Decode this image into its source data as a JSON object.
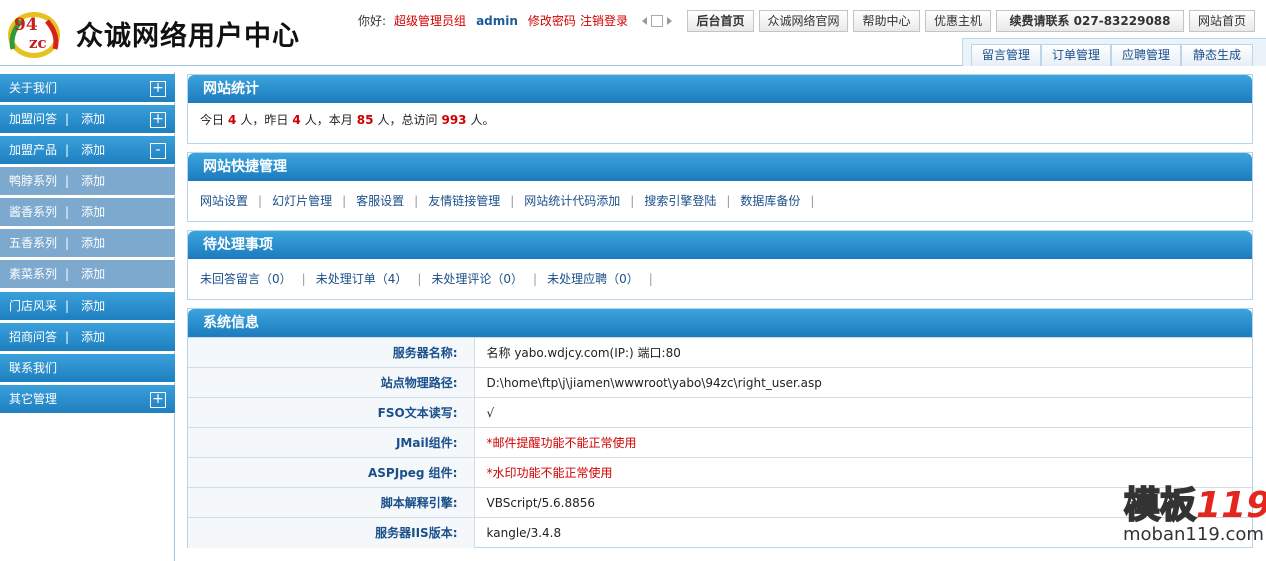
{
  "header": {
    "logo_text": "94zc",
    "brand": "众诚网络用户中心",
    "greeting": "你好:",
    "role": "超级管理员组",
    "username": "admin",
    "change_password": "修改密码",
    "logout": "注销登录",
    "top_buttons": [
      "后台首页",
      "众诚网络官网",
      "帮助中心",
      "优惠主机",
      "续费请联系 027-83229088",
      "网站首页"
    ],
    "tabs": [
      "留言管理",
      "订单管理",
      "应聘管理",
      "静态生成"
    ]
  },
  "sidebar": {
    "items": [
      {
        "label": "关于我们",
        "add": "",
        "toggle": "+"
      },
      {
        "label": "加盟问答",
        "add": "添加",
        "toggle": "+"
      },
      {
        "label": "加盟产品",
        "add": "添加",
        "toggle": "-"
      },
      {
        "label": "鸭脖系列",
        "add": "添加",
        "toggle": ""
      },
      {
        "label": "酱香系列",
        "add": "添加",
        "toggle": ""
      },
      {
        "label": "五香系列",
        "add": "添加",
        "toggle": ""
      },
      {
        "label": "素菜系列",
        "add": "添加",
        "toggle": ""
      },
      {
        "label": "门店风采",
        "add": "添加",
        "toggle": ""
      },
      {
        "label": "招商问答",
        "add": "添加",
        "toggle": ""
      },
      {
        "label": "联系我们",
        "add": "",
        "toggle": ""
      },
      {
        "label": "其它管理",
        "add": "",
        "toggle": "+"
      }
    ],
    "separator": "|"
  },
  "stats": {
    "title": "网站统计",
    "today_label": "今日",
    "today": "4",
    "yesterday_label": "人，昨日",
    "yesterday": "4",
    "month_label": "人，本月",
    "month": "85",
    "total_label": "人，总访问",
    "total": "993",
    "end": "人。"
  },
  "quick": {
    "title": "网站快捷管理",
    "links": [
      "网站设置",
      "幻灯片管理",
      "客服设置",
      "友情链接管理",
      "网站统计代码添加",
      "搜索引擎登陆",
      "数据库备份"
    ],
    "separator": "|"
  },
  "pending": {
    "title": "待处理事项",
    "links": [
      "未回答留言（0）",
      "未处理订单（4）",
      "未处理评论（0）",
      "未处理应聘（0）"
    ],
    "separator": "|"
  },
  "system": {
    "title": "系统信息",
    "rows": [
      {
        "key": "服务器名称:",
        "value": "名称 yabo.wdjcy.com(IP:) 端口:80"
      },
      {
        "key": "站点物理路径:",
        "value": "D:\\home\\ftp\\j\\jiamen\\wwwroot\\yabo\\94zc\\right_user.asp"
      },
      {
        "key": "FSO文本读写:",
        "value": "√"
      },
      {
        "key": "JMail组件:",
        "value": "*邮件提醒功能不能正常使用"
      },
      {
        "key": "ASPJpeg 组件:",
        "value": "*水印功能不能正常使用"
      },
      {
        "key": "脚本解释引擎:",
        "value": "VBScript/5.6.8856"
      },
      {
        "key": "服务器IIS版本:",
        "value": "kangle/3.4.8"
      }
    ]
  },
  "watermark": {
    "cn": "模板",
    "num": "119",
    "site": "moban119.com"
  },
  "colors": {
    "accent": "#1f7fc0",
    "sub_item": "#7ea9cf",
    "warning": "#d10000",
    "link": "#1a4f8a"
  }
}
